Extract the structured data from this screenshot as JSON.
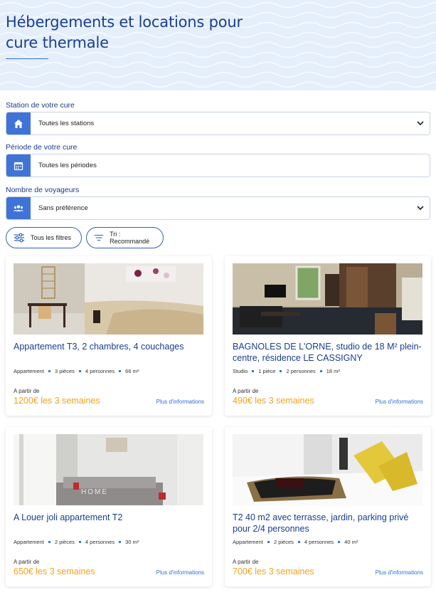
{
  "header": {
    "title_line1": "Hébergements et locations pour",
    "title_line2": "cure thermale"
  },
  "filters": {
    "station": {
      "label": "Station de votre cure",
      "value": "Toutes les stations",
      "icon": "house-icon"
    },
    "period": {
      "label": "Période de votre cure",
      "value": "Toutes les périodes",
      "icon": "calendar-icon"
    },
    "travelers": {
      "label": "Nombre de voyageurs",
      "value": "Sans préférence",
      "icon": "people-icon"
    },
    "all_filters_label": "Tous les filtres",
    "sort_label": "Tri : Recommandé"
  },
  "listings": [
    {
      "title": "Appartement T3, 2 chambres, 4 couchages",
      "type": "Appartement",
      "rooms": "3 pièces",
      "people": "4 personnes",
      "area": "66 m²",
      "from_label": "A partir de",
      "price": "1200€ les 3 semaines",
      "more_label": "Plus d'informations"
    },
    {
      "title": "BAGNOLES DE L'ORNE, studio de 18 M² plein-centre, résidence LE CASSIGNY",
      "type": "Studio",
      "rooms": "1 pièce",
      "people": "2 personnes",
      "area": "18 m²",
      "from_label": "A partir de",
      "price": "490€ les 3 semaines",
      "more_label": "Plus d'informations"
    },
    {
      "title": "A Louer joli appartement T2",
      "type": "Appartement",
      "rooms": "2 pièces",
      "people": "4 personnes",
      "area": "30 m²",
      "from_label": "A partir de",
      "price": "650€ les 3 semaines",
      "more_label": "Plus d'informations"
    },
    {
      "title": "T2 40 m2 avec terrasse, jardin, parking privé pour 2/4 personnes",
      "type": "Appartement",
      "rooms": "2 pièces",
      "people": "4 personnes",
      "area": "40 m²",
      "from_label": "A partir de",
      "price": "700€ les 3 semaines",
      "more_label": "Plus d'informations"
    }
  ],
  "colors": {
    "accent": "#3f73d8",
    "title": "#1a3d8f",
    "price": "#f2a31c",
    "hero_bg": "#e4effb"
  }
}
